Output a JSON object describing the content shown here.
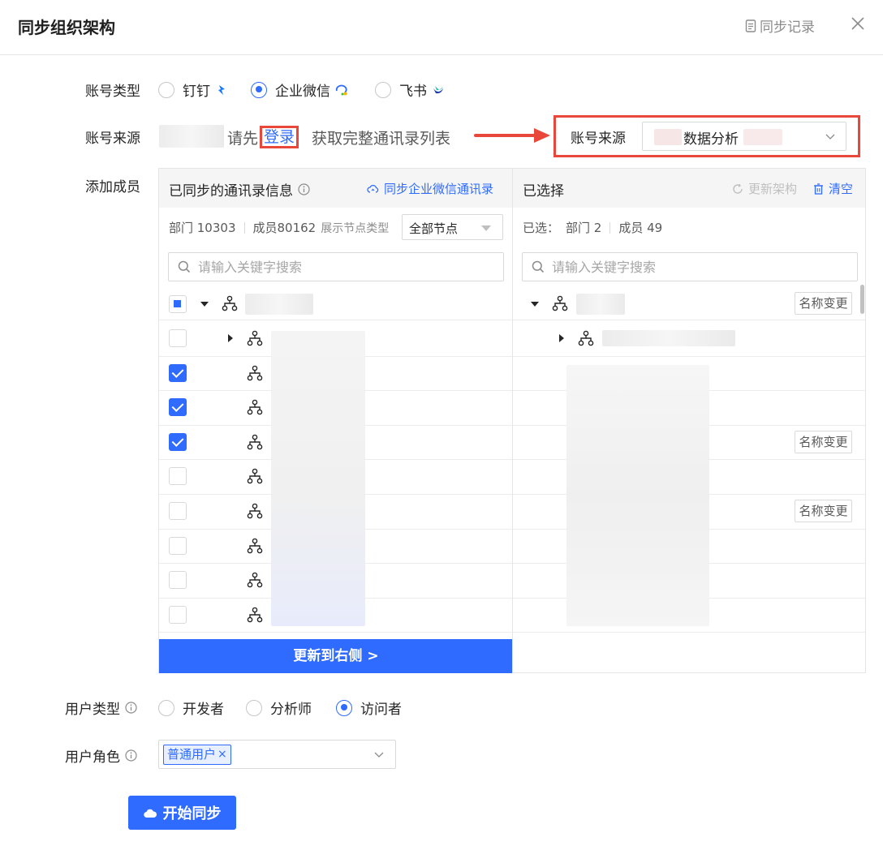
{
  "dialog": {
    "title": "同步组织架构",
    "sync_record_label": "同步记录"
  },
  "account_type": {
    "label": "账号类型",
    "options": [
      {
        "label": "钉钉",
        "selected": false,
        "icon": "dingtalk-icon"
      },
      {
        "label": "企业微信",
        "selected": true,
        "icon": "wecom-icon"
      },
      {
        "label": "飞书",
        "selected": false,
        "icon": "feishu-icon"
      }
    ]
  },
  "account_source": {
    "label": "账号来源",
    "hint_before": "请先",
    "login_link": "登录",
    "hint_after": "获取完整通讯录列表",
    "callout_label": "账号来源",
    "selected_value": "数据分析"
  },
  "add_members": {
    "label": "添加成员",
    "left": {
      "title": "已同步的通讯录信息",
      "sync_action": "同步企业微信通讯录",
      "dept_stat": "部门 10303",
      "member_stat": "成员80162",
      "node_type_label": "展示节点类型",
      "node_type_value": "全部节点",
      "search_placeholder": "请输入关键字搜索",
      "rows": [
        {
          "checked": false,
          "expandable": true
        },
        {
          "checked": true,
          "expandable": false
        },
        {
          "checked": true,
          "expandable": false
        },
        {
          "checked": true,
          "expandable": false
        },
        {
          "checked": false,
          "expandable": false
        },
        {
          "checked": false,
          "expandable": false
        },
        {
          "checked": false,
          "expandable": false
        },
        {
          "checked": false,
          "expandable": false
        },
        {
          "checked": false,
          "expandable": false
        }
      ],
      "update_button": "更新到右侧 >"
    },
    "right": {
      "title": "已选择",
      "refresh_action": "更新架构",
      "clear_action": "清空",
      "selected_prefix": "已选：",
      "dept_stat": "部门 2",
      "member_stat": "成员 49",
      "search_placeholder": "请输入关键字搜索",
      "rename_label": "名称变更"
    }
  },
  "user_type": {
    "label": "用户类型",
    "options": [
      {
        "label": "开发者",
        "selected": false
      },
      {
        "label": "分析师",
        "selected": false
      },
      {
        "label": "访问者",
        "selected": true
      }
    ]
  },
  "user_role": {
    "label": "用户角色",
    "tag": "普通用户",
    "tag_remove": "×"
  },
  "start_button": "开始同步",
  "colors": {
    "primary": "#2f6bff",
    "highlight": "#e8473a"
  }
}
